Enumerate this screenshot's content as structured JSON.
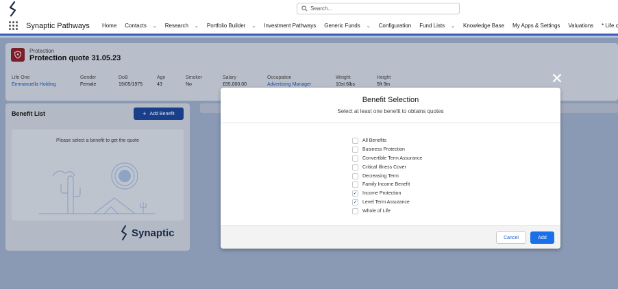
{
  "header": {
    "search_placeholder": "Search..."
  },
  "nav": {
    "app_name": "Synaptic Pathways",
    "items": [
      {
        "label": "Home",
        "has_menu": false
      },
      {
        "label": "Contacts",
        "has_menu": true
      },
      {
        "label": "Research",
        "has_menu": true
      },
      {
        "label": "Portfolio Builder",
        "has_menu": true
      },
      {
        "label": "Investment Pathways",
        "has_menu": false
      },
      {
        "label": "Generic Funds",
        "has_menu": true
      },
      {
        "label": "Configuration",
        "has_menu": false
      },
      {
        "label": "Fund Lists",
        "has_menu": true
      },
      {
        "label": "Knowledge Base",
        "has_menu": false
      },
      {
        "label": "My Apps & Settings",
        "has_menu": false
      },
      {
        "label": "Valuations",
        "has_menu": false
      },
      {
        "label": "* Life o",
        "has_menu": false
      }
    ]
  },
  "record": {
    "type": "Protection",
    "title": "Protection quote 31.05.23",
    "fields": [
      {
        "label": "Life One",
        "value": "Emmanuella Holding",
        "link": true
      },
      {
        "label": "Gender",
        "value": "Female",
        "link": false
      },
      {
        "label": "DoB",
        "value": "19/05/1975",
        "link": false
      },
      {
        "label": "Age",
        "value": "43",
        "link": false
      },
      {
        "label": "Smoker",
        "value": "No",
        "link": false
      },
      {
        "label": "Salary",
        "value": "£55,000.00",
        "link": false
      },
      {
        "label": "Occupation",
        "value": "Advertising Manager",
        "link": true
      },
      {
        "label": "Weight",
        "value": "10st 6lbs",
        "link": false
      },
      {
        "label": "Height",
        "value": "5ft 9in",
        "link": false
      }
    ]
  },
  "benefit_list": {
    "title": "Benefit List",
    "add_button": "Add Benefit",
    "empty_message": "Please select a benefit to get the quote",
    "brand": "Synaptic"
  },
  "modal": {
    "title": "Benefit Selection",
    "subtitle": "Select at least one benefit to obtains quotes",
    "options": [
      {
        "label": "All Benefits",
        "checked": false
      },
      {
        "label": "Business Protection",
        "checked": false
      },
      {
        "label": "Convertible Term Assurance",
        "checked": false
      },
      {
        "label": "Critical Illness Cover",
        "checked": false
      },
      {
        "label": "Decreasing Term",
        "checked": false
      },
      {
        "label": "Family Income Benefit",
        "checked": false
      },
      {
        "label": "Income Protection",
        "checked": true
      },
      {
        "label": "Level Term Assurance",
        "checked": true
      },
      {
        "label": "Whole of Life",
        "checked": false
      }
    ],
    "cancel_label": "Cancel",
    "add_label": "Add"
  }
}
